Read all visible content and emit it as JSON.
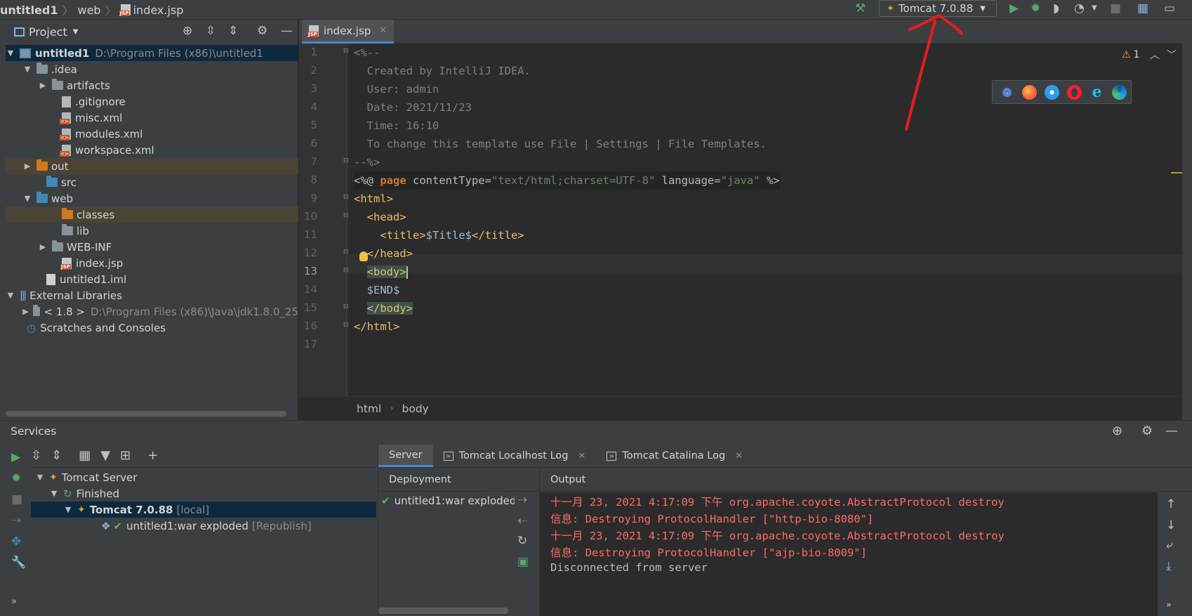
{
  "breadcrumb": {
    "project": "untitled1",
    "folder": "web",
    "file": "index.jsp"
  },
  "run_config": {
    "label": "Tomcat 7.0.88"
  },
  "project_panel": {
    "title": "Project",
    "tree": [
      {
        "label": "untitled1",
        "path": "D:\\Program Files (x86)\\untitled1"
      },
      {
        "label": ".idea"
      },
      {
        "label": "artifacts"
      },
      {
        "label": ".gitignore"
      },
      {
        "label": "misc.xml"
      },
      {
        "label": "modules.xml"
      },
      {
        "label": "workspace.xml"
      },
      {
        "label": "out"
      },
      {
        "label": "src"
      },
      {
        "label": "web"
      },
      {
        "label": "classes"
      },
      {
        "label": "lib"
      },
      {
        "label": "WEB-INF"
      },
      {
        "label": "index.jsp"
      },
      {
        "label": "untitled1.iml"
      },
      {
        "label": "External Libraries"
      },
      {
        "label": "< 1.8 >",
        "path": "D:\\Program Files (x86)\\Java\\jdk1.8.0_25"
      },
      {
        "label": "Scratches and Consoles"
      }
    ]
  },
  "editor": {
    "tab": "index.jsp",
    "line_numbers": [
      "1",
      "2",
      "3",
      "4",
      "5",
      "6",
      "7",
      "8",
      "9",
      "10",
      "11",
      "12",
      "13",
      "14",
      "15",
      "16",
      "17"
    ],
    "code": {
      "l1": "<%--",
      "l2": "  Created by IntelliJ IDEA.",
      "l3": "  User: admin",
      "l4": "  Date: 2021/11/23",
      "l5": "  Time: 16:10",
      "l6": "  To change this template use File | Settings | File Templates.",
      "l7": "--%>",
      "l8_a": "<%@ ",
      "l8_kw": "page",
      "l8_b": " contentType=",
      "l8_s1": "\"text/html;charset=UTF-8\"",
      "l8_c": " language=",
      "l8_s2": "\"java\"",
      "l8_d": " %>",
      "l9": "<html>",
      "l10": "  <head>",
      "l11_a": "    <title>",
      "l11_b": "$Title$",
      "l11_c": "</title>",
      "l12": "  </head>",
      "l13": "<body>",
      "l14": "  $END$",
      "l15": "</body>",
      "l16": "</html>"
    },
    "warning_count": "1",
    "status_path": {
      "first": "html",
      "second": "body"
    }
  },
  "services": {
    "title": "Services",
    "tree": {
      "server": "Tomcat Server",
      "finished": "Finished",
      "instance": "Tomcat 7.0.88",
      "instance_tag": "[local]",
      "artifact": "untitled1:war exploded",
      "artifact_tag": "[Republish]"
    },
    "tabs": {
      "server": "Server",
      "localhost_log": "Tomcat Localhost Log",
      "catalina_log": "Tomcat Catalina Log"
    },
    "deployment_header": "Deployment",
    "deployment_item": "untitled1:war exploded",
    "output_header": "Output",
    "output_lines": [
      "十一月 23, 2021 4:17:09 下午 org.apache.coyote.AbstractProtocol destroy",
      "信息: Destroying ProtocolHandler [\"http-bio-8080\"]",
      "十一月 23, 2021 4:17:09 下午 org.apache.coyote.AbstractProtocol destroy",
      "信息: Destroying ProtocolHandler [\"ajp-bio-8009\"]",
      "Disconnected from server"
    ]
  },
  "colors": {
    "background": "#2b2b2b",
    "panel": "#3c3f41",
    "selection": "#0d293e",
    "error_text": "#ff6b68",
    "annotation": "#e81c1c"
  }
}
